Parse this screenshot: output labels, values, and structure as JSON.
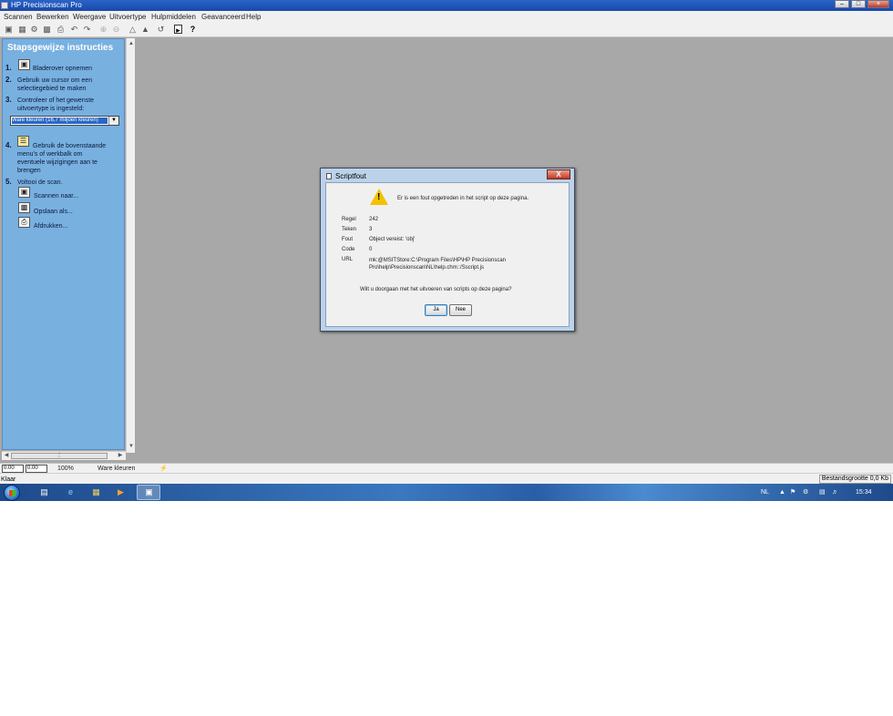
{
  "window": {
    "title": "HP Precisionscan Pro",
    "controls": {
      "minimize": "–",
      "maximize": "□",
      "close": "×"
    }
  },
  "menu": [
    "Scannen",
    "Bewerken",
    "Weergave",
    "Uitvoertype",
    "Hulpmiddelen",
    "Geavanceerd",
    "Help"
  ],
  "toolbar": {
    "icons": [
      "scan-icon",
      "scan-multi-icon",
      "settings-icon",
      "save-icon",
      "print-icon",
      "undo-icon",
      "redo-icon",
      "zoom-in-icon",
      "zoom-out-icon",
      "sharpen-icon",
      "exposure-icon",
      "rotate-icon",
      "select-icon",
      "help-pointer-icon"
    ]
  },
  "panel": {
    "title": "Stapsgewijze instructies",
    "steps": [
      {
        "num": "1.",
        "text": "Bladerover opnemen"
      },
      {
        "num": "2.",
        "text_lines": [
          "Gebruik uw cursor om een",
          "selectiegebied te maken"
        ]
      },
      {
        "num": "3.",
        "text_lines": [
          "Controleer of het gewenste",
          "uitvoertype is ingesteld:"
        ]
      },
      {
        "num": "4.",
        "text_lines": [
          "Gebruik de bovenstaande",
          "menu's of werkbalk om",
          "eventuele wijzigingen aan te",
          "brengen"
        ]
      },
      {
        "num": "5.",
        "text": "Voltooi de scan."
      }
    ],
    "output_type_selected": "Ware kleuren (16,7 miljoen kleuren)",
    "actions": [
      "Scannen naar...",
      "Opslaan als...",
      "Afdrukken..."
    ]
  },
  "params": {
    "width": "0.00",
    "height": "0.00",
    "zoom": "100%",
    "type": "Ware kleuren"
  },
  "status": {
    "left": "Klaar",
    "right": "Bestandsgrootte 0,0 Kb"
  },
  "taskbar": {
    "tray_lang": "NL",
    "clock": "15:34"
  },
  "dialog": {
    "title": "Scriptfout",
    "close": "X",
    "message": "Er is een fout opgetreden in het script op deze pagina.",
    "fields": [
      {
        "label": "Regel",
        "value": "242"
      },
      {
        "label": "Teken",
        "value": "3"
      },
      {
        "label": "Fout",
        "value": "Object vereist: 'obj'"
      },
      {
        "label": "Code",
        "value": "0"
      },
      {
        "label": "URL",
        "value": "mk:@MSITStore:C:\\Program Files\\HP\\HP Precisionscan",
        "value2": "Pro\\help\\Precisionscan\\NL\\help.chm::/Sscript.js"
      }
    ],
    "question": "Wilt u doorgaan met het uitvoeren van scripts op deze pagina?",
    "yes": "Ja",
    "no": "Nee"
  }
}
